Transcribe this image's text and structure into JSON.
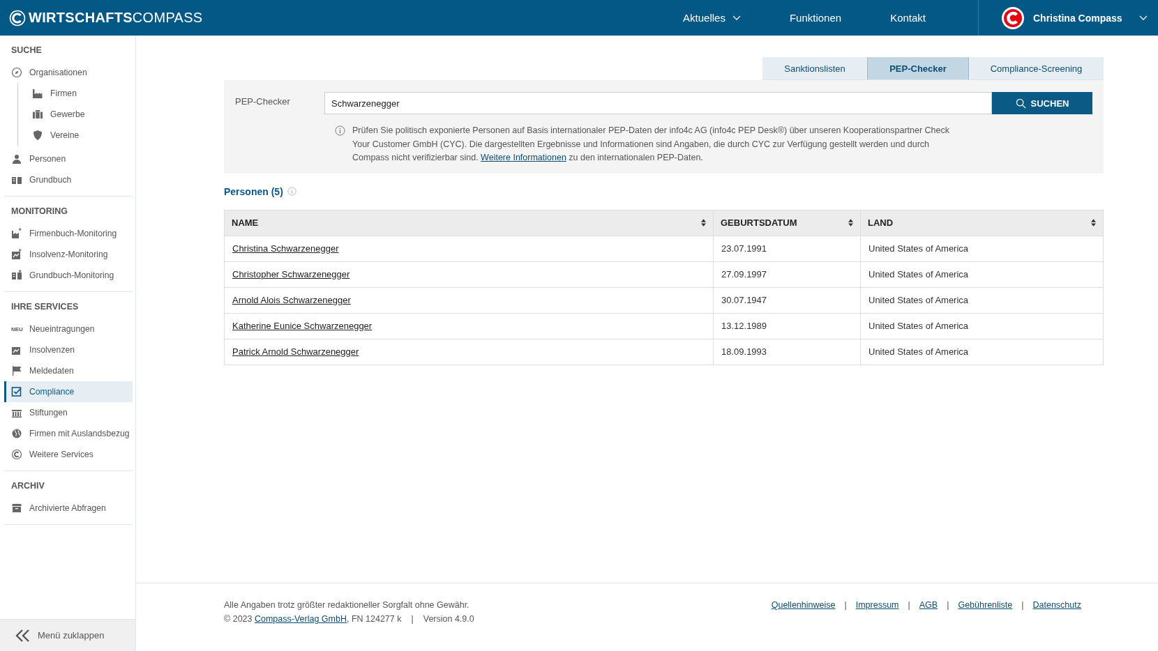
{
  "header": {
    "logo": "**WIRTSCHAFTS**COMPASS",
    "nav": [
      {
        "label": "Aktuelles",
        "dropdown": true
      },
      {
        "label": "Funktionen",
        "dropdown": false
      },
      {
        "label": "Kontakt",
        "dropdown": false
      }
    ],
    "user": {
      "name": "Christina Compass"
    }
  },
  "sidebar": {
    "sections": [
      {
        "title": "SUCHE",
        "items": [
          {
            "label": "Organisationen",
            "kind": "compass",
            "selected": false,
            "children": [
              {
                "label": "Firmen",
                "kind": "factory",
                "selected": false
              },
              {
                "label": "Gewerbe",
                "kind": "briefcase",
                "selected": false
              },
              {
                "label": "Vereine",
                "kind": "shield",
                "selected": false
              }
            ]
          },
          {
            "label": "Personen",
            "kind": "person",
            "selected": false
          },
          {
            "label": "Grundbuch",
            "kind": "book",
            "selected": false
          }
        ]
      },
      {
        "title": "MONITORING",
        "items": [
          {
            "label": "Firmenbuch-Monitoring",
            "kind": "factoryplus",
            "selected": false
          },
          {
            "label": "Insolvenz-Monitoring",
            "kind": "chartplus",
            "selected": false
          },
          {
            "label": "Grundbuch-Monitoring",
            "kind": "bookplus",
            "selected": false
          }
        ]
      },
      {
        "title": "IHRE SERVICES",
        "items": [
          {
            "label": "Neueintragungen",
            "kind": "badge",
            "badge": "NEU",
            "selected": false
          },
          {
            "label": "Insolvenzen",
            "kind": "chart",
            "selected": false
          },
          {
            "label": "Meldedaten",
            "kind": "flag",
            "selected": false
          },
          {
            "label": "Compliance",
            "kind": "check",
            "selected": true
          },
          {
            "label": "Stiftungen",
            "kind": "bank",
            "selected": false
          },
          {
            "label": "Firmen mit Auslandsbezug",
            "kind": "globe",
            "selected": false
          },
          {
            "label": "Weitere Services",
            "kind": "coin",
            "selected": false
          }
        ]
      },
      {
        "title": "ARCHIV",
        "items": [
          {
            "label": "Archivierte Abfragen",
            "kind": "archive",
            "selected": false
          }
        ]
      }
    ],
    "collapse": "Menü zuklappen"
  },
  "tabs": [
    {
      "label": "Sanktionslisten",
      "selected": false
    },
    {
      "label": "PEP-Checker",
      "selected": true
    },
    {
      "label": "Compliance-Screening",
      "selected": false
    }
  ],
  "search": {
    "label": "PEP-Checker",
    "value": "Schwarzenegger",
    "button": "SUCHEN",
    "info_before": "Prüfen Sie politisch exponierte Personen auf Basis internationaler PEP-Daten der info4c AG (info4c PEP Desk®) über unseren Kooperationspartner Check Your Customer GmbH (CYC). Die dargestellten Ergebnisse und Informationen sind Angaben, die durch CYC zur Verfügung gestellt werden und durch Compass nicht verifizierbar sind.",
    "info_link": "Weitere Informationen",
    "info_after": "zu den internationalen PEP-Daten."
  },
  "results": {
    "title": "Personen (5)",
    "columns": [
      "NAME",
      "GEBURTSDATUM",
      "LAND"
    ],
    "rows": [
      [
        "Christina Schwarzenegger",
        "23.07.1991",
        "United States of America"
      ],
      [
        "Christopher Schwarzenegger",
        "27.09.1997",
        "United States of America"
      ],
      [
        "Arnold Alois Schwarzenegger",
        "30.07.1947",
        "United States of America"
      ],
      [
        "Katherine Eunice Schwarzenegger",
        "13.12.1989",
        "United States of America"
      ],
      [
        "Patrick Arnold Schwarzenegger",
        "18.09.1993",
        "United States of America"
      ]
    ]
  },
  "footer": {
    "disclaimer": "Alle Angaben trotz größter redaktioneller Sorgfalt ohne Gewähr.",
    "copyright": "© 2023",
    "publisher_link": "Compass-Verlag GmbH",
    "register": ", FN 124277 k",
    "separator": "|",
    "version": "Version 4.9.0",
    "links": [
      "Quellenhinweise",
      "Impressum",
      "AGB",
      "Gebührenliste",
      "Datenschutz"
    ]
  }
}
